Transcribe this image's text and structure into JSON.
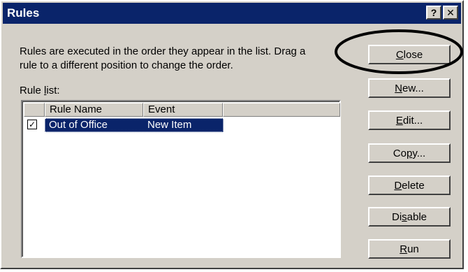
{
  "window": {
    "title": "Rules",
    "help_glyph": "?",
    "close_glyph": "✕"
  },
  "description": {
    "line1": "Rules are executed in the order they appear in the list.  Drag a",
    "line2": "rule to a different position to change the order."
  },
  "rule_list": {
    "label_pre": "Rule ",
    "label_accel": "l",
    "label_post": "ist:",
    "columns": [
      "Rule Name",
      "Event"
    ],
    "rows": [
      {
        "checked": true,
        "check_glyph": "✓",
        "rule_name": "Out of Office",
        "event": "New Item"
      }
    ]
  },
  "buttons": {
    "close": {
      "pre": "",
      "accel": "C",
      "post": "lose"
    },
    "new": {
      "pre": "",
      "accel": "N",
      "post": "ew..."
    },
    "edit": {
      "pre": "",
      "accel": "E",
      "post": "dit..."
    },
    "copy": {
      "pre": "Co",
      "accel": "p",
      "post": "y..."
    },
    "delete": {
      "pre": "",
      "accel": "D",
      "post": "elete"
    },
    "disable": {
      "pre": "Di",
      "accel": "s",
      "post": "able"
    },
    "run": {
      "pre": "",
      "accel": "R",
      "post": "un"
    }
  },
  "annotation": {
    "color": "#000000"
  },
  "colors": {
    "titlebar": "#0a246a",
    "face": "#d4d0c8",
    "selection": "#0a246a"
  }
}
